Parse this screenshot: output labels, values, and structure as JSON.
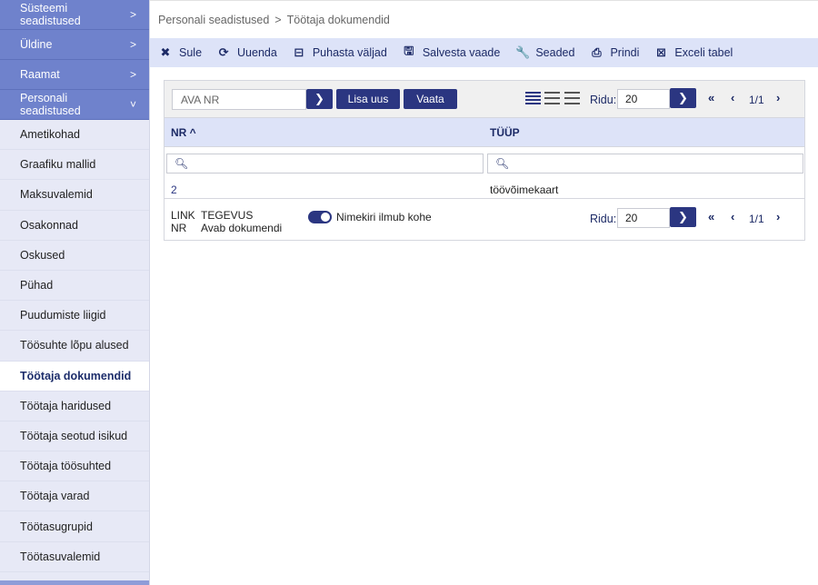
{
  "sidebar": {
    "categories": [
      {
        "label": "Süsteemi seadistused",
        "chevron": ">"
      },
      {
        "label": "Üldine",
        "chevron": ">"
      },
      {
        "label": "Raamat",
        "chevron": ">"
      },
      {
        "label": "Personali seadistused",
        "chevron": "˅"
      }
    ],
    "items": [
      {
        "label": "Ametikohad"
      },
      {
        "label": "Graafiku mallid"
      },
      {
        "label": "Maksuvalemid"
      },
      {
        "label": "Osakonnad"
      },
      {
        "label": "Oskused"
      },
      {
        "label": "Pühad"
      },
      {
        "label": "Puudumiste liigid"
      },
      {
        "label": "Töösuhte lõpu alused"
      },
      {
        "label": "Töötaja dokumendid"
      },
      {
        "label": "Töötaja haridused"
      },
      {
        "label": "Töötaja seotud isikud"
      },
      {
        "label": "Töötaja töösuhted"
      },
      {
        "label": "Töötaja varad"
      },
      {
        "label": "Töötasugrupid"
      },
      {
        "label": "Töötasuvalemid"
      }
    ]
  },
  "breadcrumb": {
    "parent": "Personali seadistused",
    "sep": ">",
    "current": "Töötaja dokumendid"
  },
  "toolbar": {
    "close": "Sule",
    "refresh": "Uuenda",
    "clear": "Puhasta väljad",
    "save_view": "Salvesta vaade",
    "settings": "Seaded",
    "print": "Prindi",
    "excel": "Exceli tabel"
  },
  "panel": {
    "nr_placeholder": "AVA NR",
    "add_new": "Lisa uus",
    "view": "Vaata",
    "rows_label": "Ridu:",
    "rows_value": "20",
    "page": "1/1",
    "columns": {
      "nr": "NR ^",
      "type": "TÜÜP"
    },
    "rows": [
      {
        "nr": "2",
        "type": "töövõimekaart"
      }
    ],
    "footer": {
      "link": "LINK",
      "nr": "NR",
      "action": "TEGEVUS",
      "action_value": "Avab dokumendi",
      "toggle_label": "Nimekiri ilmub kohe"
    }
  }
}
